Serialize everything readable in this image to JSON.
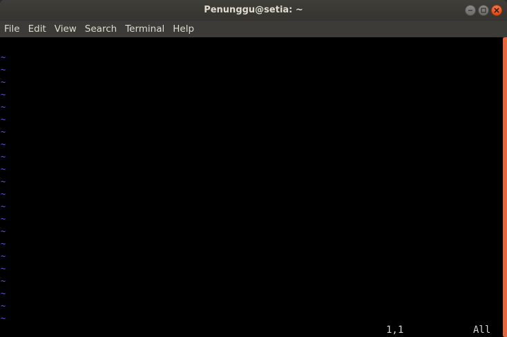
{
  "window": {
    "title": "Penunggu@setia: ~"
  },
  "menu": {
    "items": [
      {
        "label": "File"
      },
      {
        "label": "Edit"
      },
      {
        "label": "View"
      },
      {
        "label": "Search"
      },
      {
        "label": "Terminal"
      },
      {
        "label": "Help"
      }
    ]
  },
  "editor": {
    "empty_line_marker": "~",
    "empty_line_count": 22,
    "status": {
      "cursor_position": "1,1",
      "scroll_position": "All"
    }
  },
  "colors": {
    "accent_scrollbar": "#e7663d",
    "tilde": "#5a5af5",
    "terminal_bg": "#000000",
    "chrome_bg": "#3c3b37"
  },
  "icons": {
    "minimize": "minimize-icon",
    "maximize": "maximize-icon",
    "close": "close-icon"
  }
}
